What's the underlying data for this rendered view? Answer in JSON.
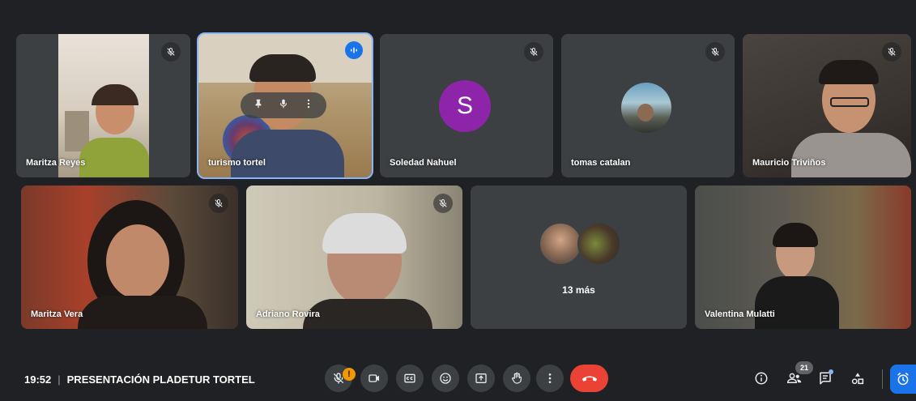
{
  "participants": [
    {
      "name": "Maritza Reyes"
    },
    {
      "name": "turismo tortel"
    },
    {
      "name": "Soledad Nahuel",
      "initial": "S"
    },
    {
      "name": "tomas catalan"
    },
    {
      "name": "Mauricio Triviños"
    },
    {
      "name": "Maritza Vera"
    },
    {
      "name": "Adriano Rovira"
    },
    {
      "name": "Valentina Mulatti"
    }
  ],
  "more_tile": {
    "label": "13 más"
  },
  "footer": {
    "time": "19:52",
    "separator": "|",
    "meeting_title": "PRESENTACIÓN PLADETUR TORTEL"
  },
  "badges": {
    "people_count": "21",
    "mic_warning": "!"
  },
  "colors": {
    "background": "#202124",
    "tile": "#3c4043",
    "accent": "#8ab4f8",
    "hangup": "#ea4335",
    "avatar_s": "#8e24aa",
    "warning": "#f29900"
  },
  "icons": [
    "mic-off-icon",
    "speaking-icon",
    "pin-icon",
    "more-vert-icon",
    "camera-icon",
    "captions-icon",
    "emoji-icon",
    "present-icon",
    "raise-hand-icon",
    "end-call-icon",
    "info-icon",
    "people-icon",
    "chat-icon",
    "activities-icon",
    "host-controls-icon"
  ]
}
